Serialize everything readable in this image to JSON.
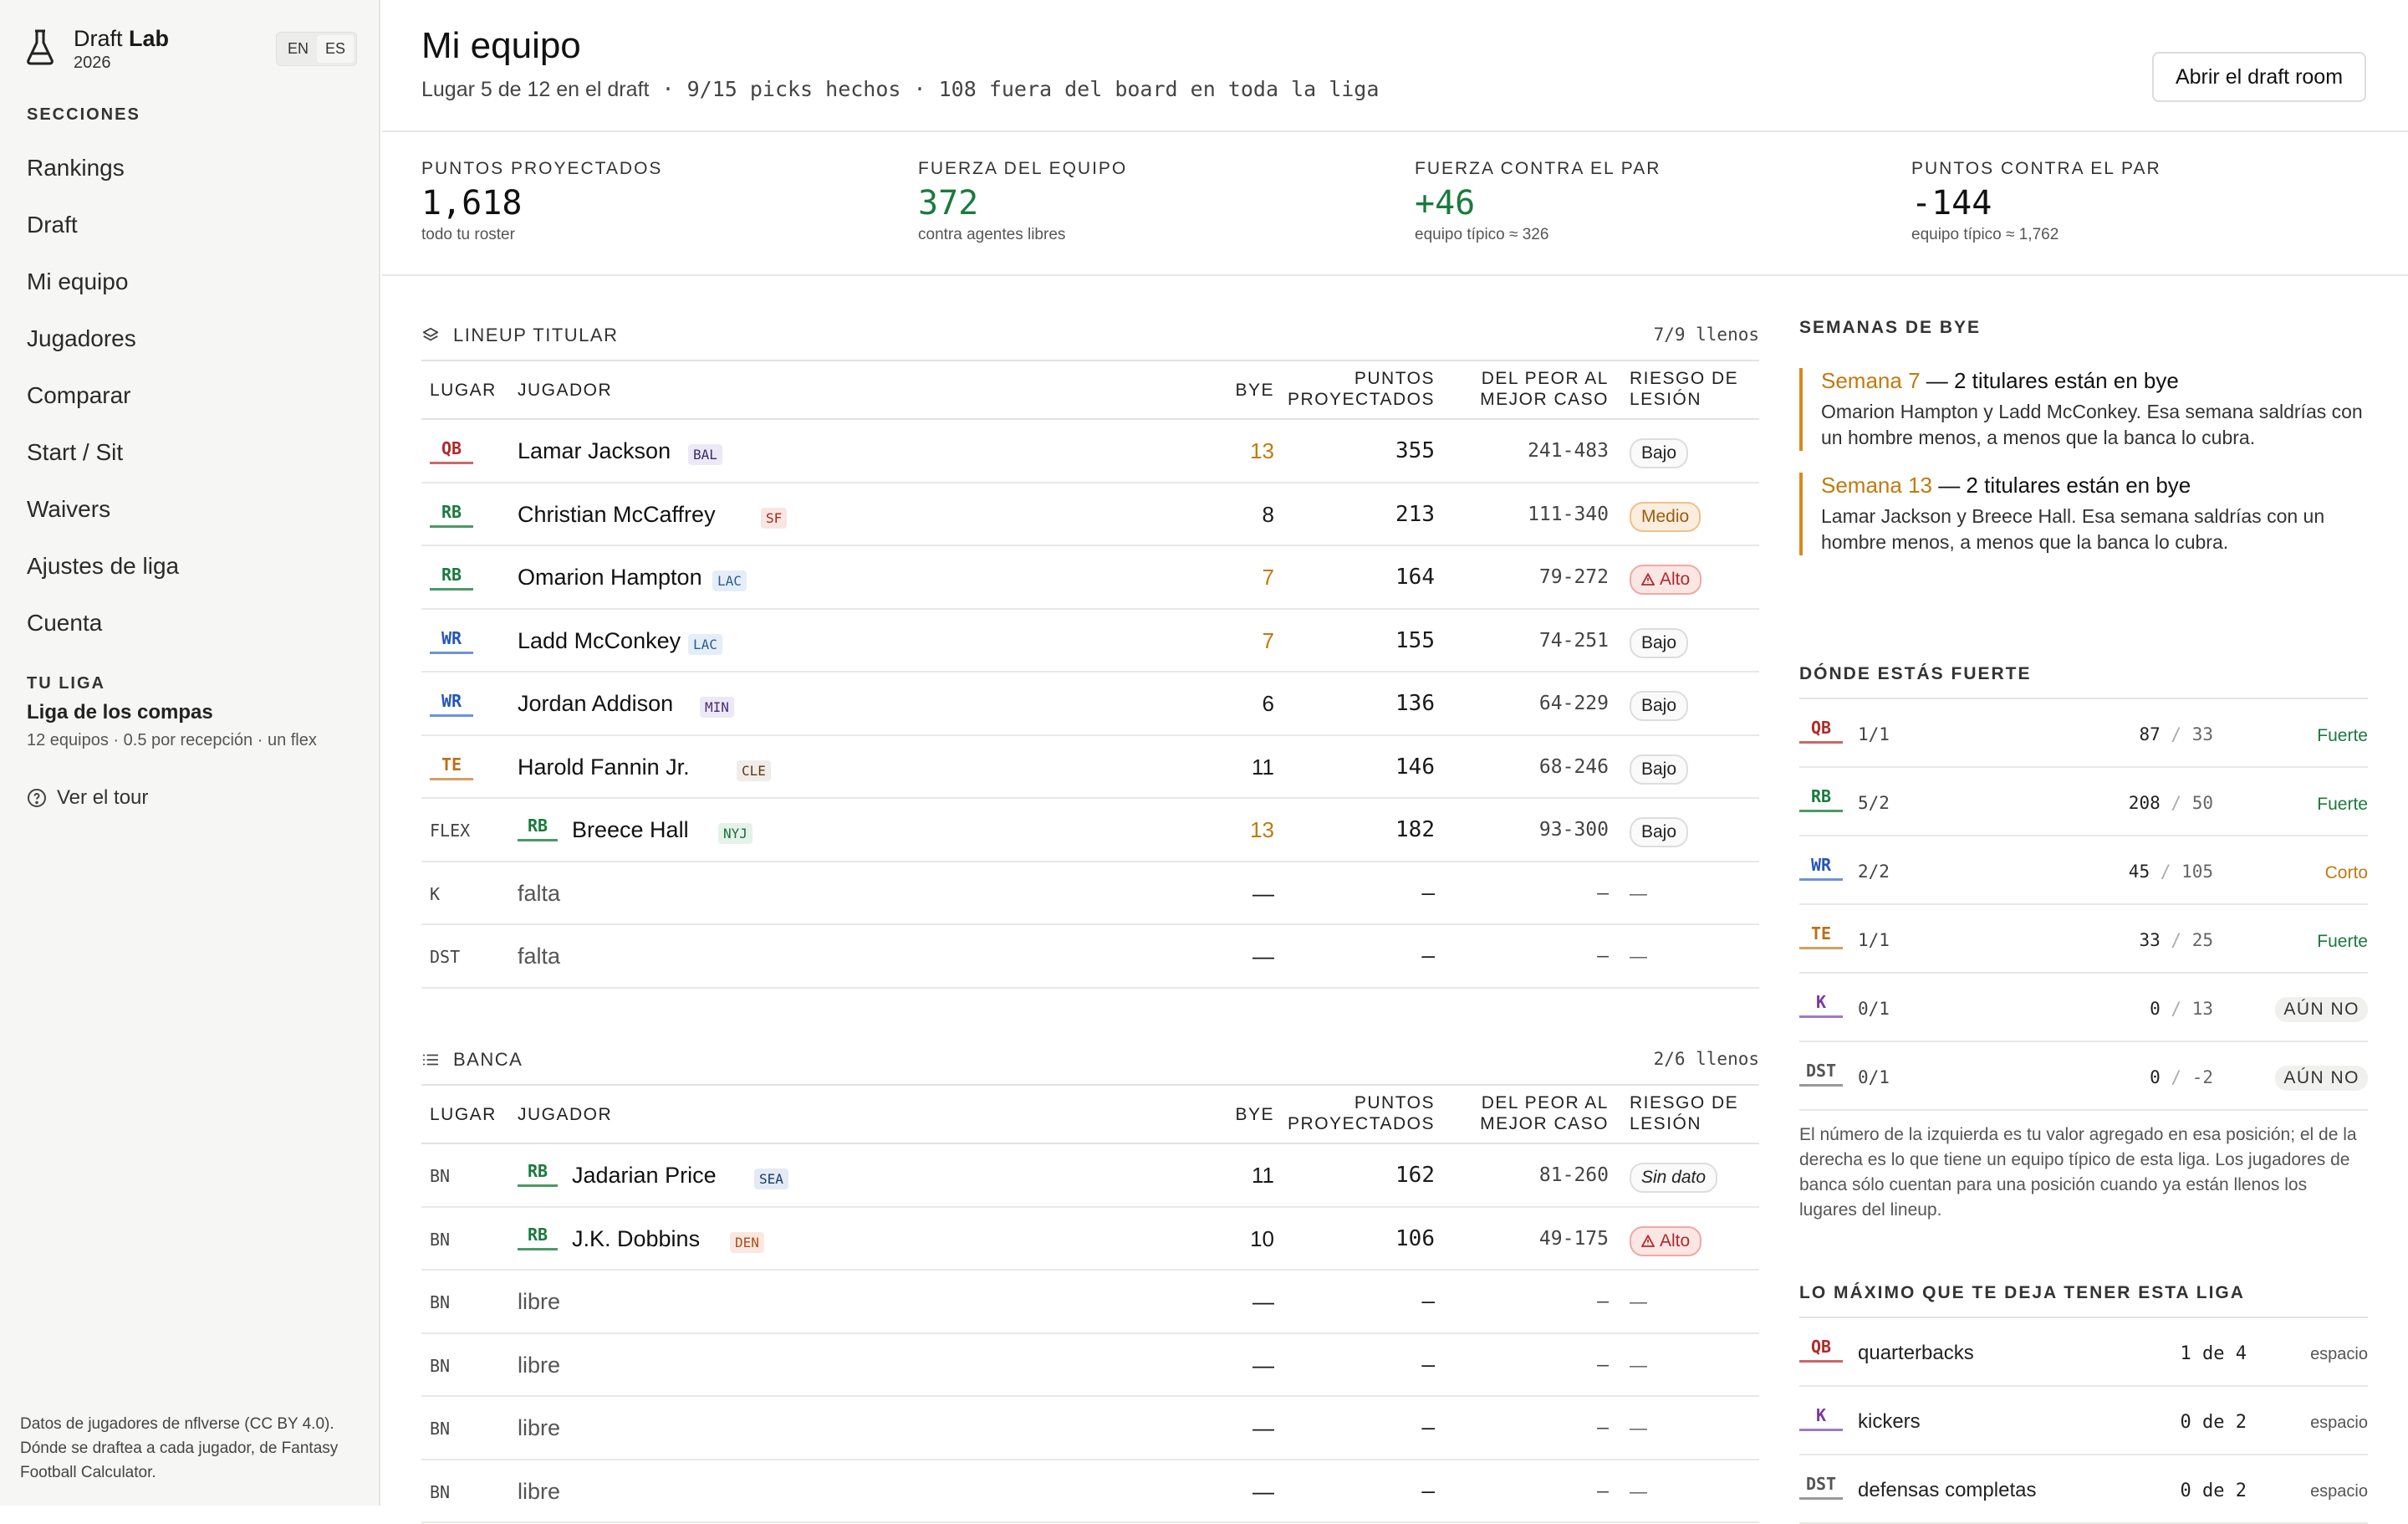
{
  "sidebar": {
    "brand_name_light": "Draft",
    "brand_name_bold": "Lab",
    "brand_year": "2026",
    "lang_en": "EN",
    "lang_es": "ES",
    "sections_label": "SECCIONES",
    "nav": [
      "Rankings",
      "Draft",
      "Mi equipo",
      "Jugadores",
      "Comparar",
      "Start / Sit",
      "Waivers",
      "Ajustes de liga",
      "Cuenta"
    ],
    "league_label": "TU LIGA",
    "league_name": "Liga de los compas",
    "league_sub": "12 equipos · 0.5 por recepción · un flex",
    "tour": "Ver el tour",
    "footer": "Datos de jugadores de nflverse (CC BY 4.0). Dónde se draftea a cada jugador, de Fantasy Football Calculator."
  },
  "header": {
    "title": "Mi equipo",
    "subtitle_text": "Lugar 5 de 12 en el draft",
    "subtitle_mono": " · 9/15 picks hechos · 108 fuera del board en toda la liga",
    "draft_room_button": "Abrir el draft room"
  },
  "stats": [
    {
      "label": "PUNTOS PROYECTADOS",
      "value": "1,618",
      "sub": "todo tu roster",
      "color": "dark"
    },
    {
      "label": "FUERZA DEL EQUIPO",
      "value": "372",
      "sub": "contra agentes libres",
      "color": "green"
    },
    {
      "label": "FUERZA CONTRA EL PAR",
      "value": "+46",
      "sub": "equipo típico ≈ 326",
      "color": "green"
    },
    {
      "label": "PUNTOS CONTRA EL PAR",
      "value": "-144",
      "sub": "equipo típico ≈ 1,762",
      "color": "dark"
    }
  ],
  "columns": {
    "slot": "LUGAR",
    "player": "JUGADOR",
    "bye": "BYE",
    "proj1": "PUNTOS",
    "proj2": "PROYECTADOS",
    "range1": "DEL PEOR AL",
    "range2": "MEJOR CASO",
    "risk1": "RIESGO DE",
    "risk2": "LESIÓN"
  },
  "lineup": {
    "title": "LINEUP TITULAR",
    "count": "7/9 llenos",
    "rows": [
      {
        "slot": "QB",
        "pos": "QB",
        "name": "Lamar Jackson",
        "team": "BAL",
        "bye": "13",
        "bye_warn": true,
        "proj": "355",
        "range": "241-483",
        "risk": "Bajo"
      },
      {
        "slot": "RB",
        "pos": "RB",
        "name": "Christian McCaffrey",
        "team": "SF",
        "bye": "8",
        "bye_warn": false,
        "proj": "213",
        "range": "111-340",
        "risk": "Medio"
      },
      {
        "slot": "RB",
        "pos": "RB",
        "name": "Omarion Hampton",
        "team": "LAC",
        "bye": "7",
        "bye_warn": true,
        "proj": "164",
        "range": "79-272",
        "risk": "Alto"
      },
      {
        "slot": "WR",
        "pos": "WR",
        "name": "Ladd McConkey",
        "team": "LAC",
        "bye": "7",
        "bye_warn": true,
        "proj": "155",
        "range": "74-251",
        "risk": "Bajo"
      },
      {
        "slot": "WR",
        "pos": "WR",
        "name": "Jordan Addison",
        "team": "MIN",
        "bye": "6",
        "bye_warn": false,
        "proj": "136",
        "range": "64-229",
        "risk": "Bajo"
      },
      {
        "slot": "TE",
        "pos": "TE",
        "name": "Harold Fannin Jr.",
        "team": "CLE",
        "bye": "11",
        "bye_warn": false,
        "proj": "146",
        "range": "68-246",
        "risk": "Bajo"
      },
      {
        "slot": "FLEX",
        "pos": "RB",
        "name": "Breece Hall",
        "team": "NYJ",
        "bye": "13",
        "bye_warn": true,
        "proj": "182",
        "range": "93-300",
        "risk": "Bajo"
      },
      {
        "slot": "K",
        "pos": "",
        "name": "falta",
        "team": "",
        "bye": "—",
        "bye_warn": false,
        "proj": "—",
        "range": "—",
        "risk": "—"
      },
      {
        "slot": "DST",
        "pos": "",
        "name": "falta",
        "team": "",
        "bye": "—",
        "bye_warn": false,
        "proj": "—",
        "range": "—",
        "risk": "—"
      }
    ]
  },
  "bench": {
    "title": "BANCA",
    "count": "2/6 llenos",
    "rows": [
      {
        "slot": "BN",
        "pos": "RB",
        "name": "Jadarian Price",
        "team": "SEA",
        "bye": "11",
        "bye_warn": false,
        "proj": "162",
        "range": "81-260",
        "risk": "Sin dato"
      },
      {
        "slot": "BN",
        "pos": "RB",
        "name": "J.K. Dobbins",
        "team": "DEN",
        "bye": "10",
        "bye_warn": false,
        "proj": "106",
        "range": "49-175",
        "risk": "Alto"
      },
      {
        "slot": "BN",
        "pos": "",
        "name": "libre",
        "team": "",
        "bye": "—",
        "bye_warn": false,
        "proj": "—",
        "range": "—",
        "risk": "—"
      },
      {
        "slot": "BN",
        "pos": "",
        "name": "libre",
        "team": "",
        "bye": "—",
        "bye_warn": false,
        "proj": "—",
        "range": "—",
        "risk": "—"
      },
      {
        "slot": "BN",
        "pos": "",
        "name": "libre",
        "team": "",
        "bye": "—",
        "bye_warn": false,
        "proj": "—",
        "range": "—",
        "risk": "—"
      },
      {
        "slot": "BN",
        "pos": "",
        "name": "libre",
        "team": "",
        "bye": "—",
        "bye_warn": false,
        "proj": "—",
        "range": "—",
        "risk": "—"
      }
    ]
  },
  "bye_weeks": {
    "title": "SEMANAS DE BYE",
    "cards": [
      {
        "week": "Semana 7",
        "rest": " — 2 titulares están en bye",
        "desc": "Omarion Hampton y Ladd McConkey. Esa semana saldrías con un hombre menos, a menos que la banca lo cubra."
      },
      {
        "week": "Semana 13",
        "rest": " — 2 titulares están en bye",
        "desc": "Lamar Jackson y Breece Hall. Esa semana saldrías con un hombre menos, a menos que la banca lo cubra."
      }
    ]
  },
  "strengths": {
    "title": "DÓNDE ESTÁS FUERTE",
    "rows": [
      {
        "pos": "QB",
        "frac": "1/1",
        "mine": "87",
        "typical": "33",
        "label": "Fuerte",
        "style": "Fuerte"
      },
      {
        "pos": "RB",
        "frac": "5/2",
        "mine": "208",
        "typical": "50",
        "label": "Fuerte",
        "style": "Fuerte"
      },
      {
        "pos": "WR",
        "frac": "2/2",
        "mine": "45",
        "typical": "105",
        "label": "Corto",
        "style": "Corto"
      },
      {
        "pos": "TE",
        "frac": "1/1",
        "mine": "33",
        "typical": "25",
        "label": "Fuerte",
        "style": "Fuerte"
      },
      {
        "pos": "K",
        "frac": "0/1",
        "mine": "0",
        "typical": "13",
        "label": "AÚN NO",
        "style": "pill"
      },
      {
        "pos": "DST",
        "frac": "0/1",
        "mine": "0",
        "typical": "-2",
        "label": "AÚN NO",
        "style": "pill"
      }
    ],
    "note": "El número de la izquierda es tu valor agregado en esa posición; el de la derecha es lo que tiene un equipo típico de esta liga. Los jugadores de banca sólo cuentan para una posición cuando ya están llenos los lugares del lineup."
  },
  "max": {
    "title": "LO MÁXIMO QUE TE DEJA TENER ESTA LIGA",
    "rows": [
      {
        "pos": "QB",
        "name": "quarterbacks",
        "val": "1 de 4",
        "space": "espacio"
      },
      {
        "pos": "K",
        "name": "kickers",
        "val": "0 de 2",
        "space": "espacio"
      },
      {
        "pos": "DST",
        "name": "defensas completas",
        "val": "0 de 2",
        "space": "espacio"
      }
    ]
  },
  "colors": {
    "accent_green": "#1a7a3c",
    "warn_orange": "#c07a10",
    "danger_red": "#b02a2a"
  }
}
